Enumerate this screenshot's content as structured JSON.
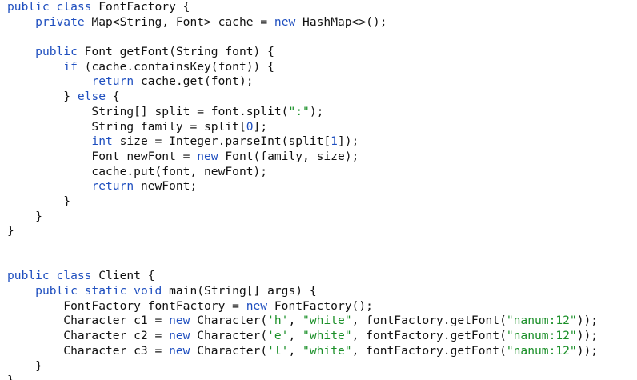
{
  "editor": {
    "language": "java",
    "colors": {
      "background": "#ffffff",
      "text": "#111111",
      "keyword": "#1f4fbf",
      "string": "#1a8f28",
      "number": "#1f4fbf"
    },
    "lines": [
      [
        [
          "kw",
          "public class"
        ],
        [
          "id",
          " FontFactory {"
        ]
      ],
      [
        [
          "id",
          "    "
        ],
        [
          "kw",
          "private"
        ],
        [
          "id",
          " Map<String, Font> cache = "
        ],
        [
          "kw",
          "new"
        ],
        [
          "id",
          " HashMap<>();"
        ]
      ],
      [
        [
          "id",
          ""
        ]
      ],
      [
        [
          "id",
          "    "
        ],
        [
          "kw",
          "public"
        ],
        [
          "id",
          " Font getFont(String font) {"
        ]
      ],
      [
        [
          "id",
          "        "
        ],
        [
          "kw",
          "if"
        ],
        [
          "id",
          " (cache.containsKey(font)) {"
        ]
      ],
      [
        [
          "id",
          "            "
        ],
        [
          "kw",
          "return"
        ],
        [
          "id",
          " cache.get(font);"
        ]
      ],
      [
        [
          "id",
          "        } "
        ],
        [
          "kw",
          "else"
        ],
        [
          "id",
          " {"
        ]
      ],
      [
        [
          "id",
          "            String[] split = font.split("
        ],
        [
          "str",
          "\":\""
        ],
        [
          "id",
          ");"
        ]
      ],
      [
        [
          "id",
          "            String family = split["
        ],
        [
          "num",
          "0"
        ],
        [
          "id",
          "];"
        ]
      ],
      [
        [
          "id",
          "            "
        ],
        [
          "kw",
          "int"
        ],
        [
          "id",
          " size = Integer.parseInt(split["
        ],
        [
          "num",
          "1"
        ],
        [
          "id",
          "]);"
        ]
      ],
      [
        [
          "id",
          "            Font newFont = "
        ],
        [
          "kw",
          "new"
        ],
        [
          "id",
          " Font(family, size);"
        ]
      ],
      [
        [
          "id",
          "            cache.put(font, newFont);"
        ]
      ],
      [
        [
          "id",
          "            "
        ],
        [
          "kw",
          "return"
        ],
        [
          "id",
          " newFont;"
        ]
      ],
      [
        [
          "id",
          "        }"
        ]
      ],
      [
        [
          "id",
          "    }"
        ]
      ],
      [
        [
          "id",
          "}"
        ]
      ],
      [
        [
          "id",
          ""
        ]
      ],
      [
        [
          "id",
          ""
        ]
      ],
      [
        [
          "kw",
          "public class"
        ],
        [
          "id",
          " Client {"
        ]
      ],
      [
        [
          "id",
          "    "
        ],
        [
          "kw",
          "public static void"
        ],
        [
          "id",
          " main(String[] args) {"
        ]
      ],
      [
        [
          "id",
          "        FontFactory fontFactory = "
        ],
        [
          "kw",
          "new"
        ],
        [
          "id",
          " FontFactory();"
        ]
      ],
      [
        [
          "id",
          "        Character c1 = "
        ],
        [
          "kw",
          "new"
        ],
        [
          "id",
          " Character("
        ],
        [
          "str",
          "'h'"
        ],
        [
          "id",
          ", "
        ],
        [
          "str",
          "\"white\""
        ],
        [
          "id",
          ", fontFactory.getFont("
        ],
        [
          "str",
          "\"nanum:12\""
        ],
        [
          "id",
          "));"
        ]
      ],
      [
        [
          "id",
          "        Character c2 = "
        ],
        [
          "kw",
          "new"
        ],
        [
          "id",
          " Character("
        ],
        [
          "str",
          "'e'"
        ],
        [
          "id",
          ", "
        ],
        [
          "str",
          "\"white\""
        ],
        [
          "id",
          ", fontFactory.getFont("
        ],
        [
          "str",
          "\"nanum:12\""
        ],
        [
          "id",
          "));"
        ]
      ],
      [
        [
          "id",
          "        Character c3 = "
        ],
        [
          "kw",
          "new"
        ],
        [
          "id",
          " Character("
        ],
        [
          "str",
          "'l'"
        ],
        [
          "id",
          ", "
        ],
        [
          "str",
          "\"white\""
        ],
        [
          "id",
          ", fontFactory.getFont("
        ],
        [
          "str",
          "\"nanum:12\""
        ],
        [
          "id",
          "));"
        ]
      ],
      [
        [
          "id",
          "    }"
        ]
      ],
      [
        [
          "id",
          "}"
        ]
      ]
    ]
  }
}
